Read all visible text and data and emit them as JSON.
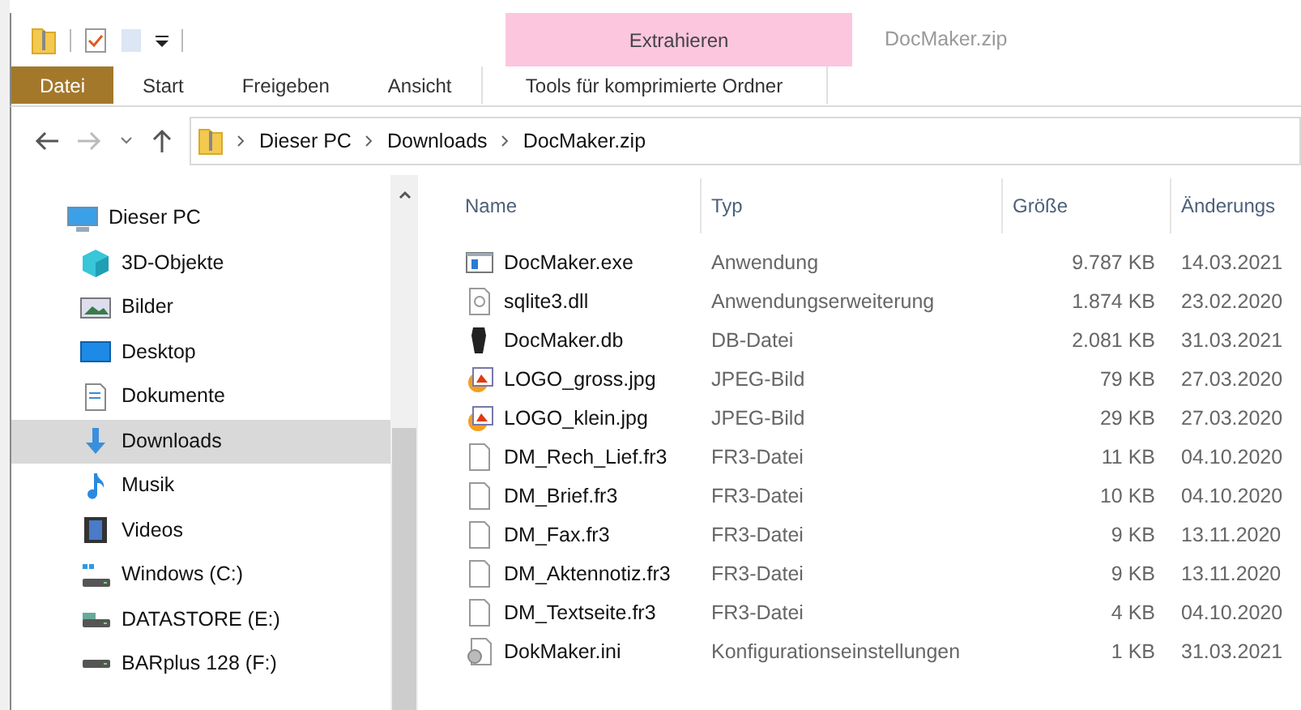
{
  "window": {
    "title": "DocMaker.zip",
    "context_group": "Extrahieren"
  },
  "ribbon_tabs": [
    {
      "label": "Datei",
      "kind": "file",
      "selected": false
    },
    {
      "label": "Start",
      "kind": "plain",
      "selected": false
    },
    {
      "label": "Freigeben",
      "kind": "plain",
      "selected": false
    },
    {
      "label": "Ansicht",
      "kind": "plain",
      "selected": false
    },
    {
      "label": "Tools für komprimierte Ordner",
      "kind": "context",
      "selected": true
    }
  ],
  "address": {
    "crumbs": [
      "Dieser PC",
      "Downloads",
      "DocMaker.zip"
    ]
  },
  "sidebar": {
    "items": [
      {
        "label": "Dieser PC",
        "kind": "pc",
        "selected": false,
        "children": [
          {
            "label": "3D-Objekte",
            "kind": "cube",
            "selected": false
          },
          {
            "label": "Bilder",
            "kind": "pictures",
            "selected": false
          },
          {
            "label": "Desktop",
            "kind": "desktop",
            "selected": false
          },
          {
            "label": "Dokumente",
            "kind": "documents",
            "selected": false
          },
          {
            "label": "Downloads",
            "kind": "downloads",
            "selected": true
          },
          {
            "label": "Musik",
            "kind": "music",
            "selected": false
          },
          {
            "label": "Videos",
            "kind": "videos",
            "selected": false
          },
          {
            "label": "Windows (C:)",
            "kind": "windrive",
            "selected": false
          },
          {
            "label": "DATASTORE (E:)",
            "kind": "netdrive",
            "selected": false
          },
          {
            "label": "BARplus 128 (F:)",
            "kind": "drive",
            "selected": false
          }
        ]
      }
    ]
  },
  "table": {
    "columns": [
      "Name",
      "Typ",
      "Größe",
      "Änderungs"
    ],
    "rows": [
      {
        "name": "DocMaker.exe",
        "type": "Anwendung",
        "size": "9.787 KB",
        "date": "14.03.2021",
        "kind": "exe"
      },
      {
        "name": "sqlite3.dll",
        "type": "Anwendungserweiterung",
        "size": "1.874 KB",
        "date": "23.02.2020",
        "kind": "dll"
      },
      {
        "name": "DocMaker.db",
        "type": "DB-Datei",
        "size": "2.081 KB",
        "date": "31.03.2021",
        "kind": "db"
      },
      {
        "name": "LOGO_gross.jpg",
        "type": "JPEG-Bild",
        "size": "79 KB",
        "date": "27.03.2020",
        "kind": "image"
      },
      {
        "name": "LOGO_klein.jpg",
        "type": "JPEG-Bild",
        "size": "29 KB",
        "date": "27.03.2020",
        "kind": "image"
      },
      {
        "name": "DM_Rech_Lief.fr3",
        "type": "FR3-Datei",
        "size": "11 KB",
        "date": "04.10.2020",
        "kind": "file"
      },
      {
        "name": "DM_Brief.fr3",
        "type": "FR3-Datei",
        "size": "10 KB",
        "date": "04.10.2020",
        "kind": "file"
      },
      {
        "name": "DM_Fax.fr3",
        "type": "FR3-Datei",
        "size": "9 KB",
        "date": "13.11.2020",
        "kind": "file"
      },
      {
        "name": "DM_Aktennotiz.fr3",
        "type": "FR3-Datei",
        "size": "9 KB",
        "date": "13.11.2020",
        "kind": "file"
      },
      {
        "name": "DM_Textseite.fr3",
        "type": "FR3-Datei",
        "size": "4 KB",
        "date": "04.10.2020",
        "kind": "file"
      },
      {
        "name": "DokMaker.ini",
        "type": "Konfigurationseinstellungen",
        "size": "1 KB",
        "date": "31.03.2021",
        "kind": "ini"
      }
    ]
  }
}
